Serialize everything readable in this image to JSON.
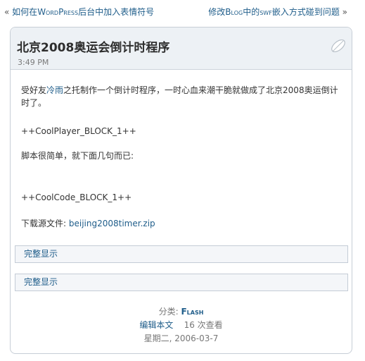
{
  "nav": {
    "prev_arrow": "«",
    "prev_text_1": "如何在",
    "prev_text_sc": "WordPress",
    "prev_text_2": "后台中加入表情符号",
    "next_text_1": "修改",
    "next_text_sc": "Blog",
    "next_text_2": "中的",
    "next_text_sc2": "swf",
    "next_text_3": "嵌入方式碰到问题",
    "next_arrow": "»"
  },
  "post": {
    "title": "北京2008奥运会倒计时程序",
    "time": "3:49 PM",
    "intro_1": "受好友",
    "intro_link": "冷雨",
    "intro_2": "之托制作一个倒计时程序，一时心血来潮干脆就做成了北京2008奥运倒计时了。",
    "player_block": "++CoolPlayer_BLOCK_1++",
    "script_note": "脚本很简单，就下面几句而已:",
    "code_block": "++CoolCode_BLOCK_1++",
    "download_label": "下载源文件:",
    "download_link": "beijing2008timer.zip",
    "toggle_1": "完整显示",
    "toggle_2": "完整显示"
  },
  "meta": {
    "category_label": "分类:",
    "category": "Flash",
    "edit": "编辑本文",
    "views": "16 次查看",
    "date": "星期二, 2006-03-7"
  },
  "colors": {
    "link": "#1f5d8a",
    "header_bg": "#edf1f5",
    "border": "#c7ced6"
  },
  "icons": {
    "feather": "feather-icon"
  }
}
